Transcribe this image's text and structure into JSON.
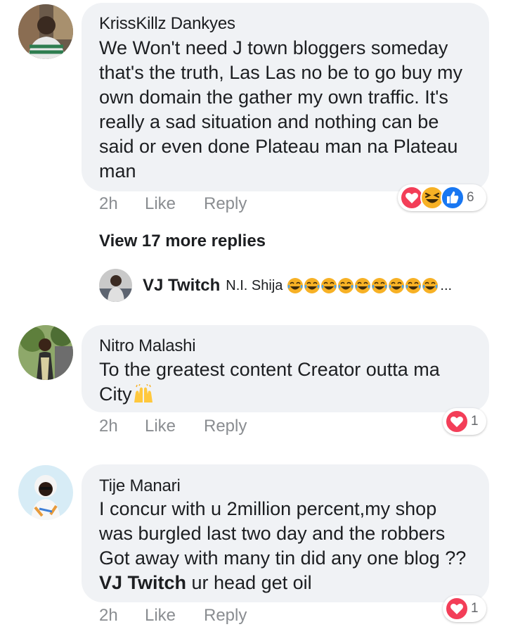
{
  "comments": [
    {
      "author": "KrissKillz Dankyes",
      "lines": [
        "We Won't need J town bloggers someday",
        "that's the truth, Las Las no be to go buy my",
        "own domain the gather my own traffic. It's",
        "really a sad situation and nothing can be",
        "said or even done Plateau man na Plateau",
        "man"
      ],
      "time": "2h",
      "like": "Like",
      "reply": "Reply",
      "reactions": [
        "love-icon",
        "haha-icon",
        "like-icon"
      ],
      "reaction_count": "6"
    },
    {
      "author": "Nitro Malashi",
      "lines": [
        "To the greatest content Creator outta ma",
        "City"
      ],
      "emoji": "raising-hands-icon",
      "time": "2h",
      "like": "Like",
      "reply": "Reply",
      "reactions": [
        "love-icon"
      ],
      "reaction_count": "1"
    },
    {
      "author": "Tije Manari",
      "lines": [
        "I concur with u 2million percent,my shop",
        "was burgled last two day and the robbers",
        "Got away with many tin did any one blog ??"
      ],
      "mention": "VJ Twitch",
      "last_line_rest": " ur head get oil",
      "time": "2h",
      "like": "Like",
      "reply": "Reply",
      "reactions": [
        "love-icon"
      ],
      "reaction_count": "1"
    }
  ],
  "replies": {
    "view_more": "View 17 more replies",
    "preview_author": "VJ Twitch",
    "preview_text": "N.I. Shija",
    "preview_emoji": "tears-of-joy-icon",
    "preview_ellipsis": "..."
  },
  "colors": {
    "bubble": "#f0f2f5",
    "muted": "#8a8d91",
    "love": "#f33e58",
    "haha": "#f7b125",
    "like": "#1877f2"
  }
}
